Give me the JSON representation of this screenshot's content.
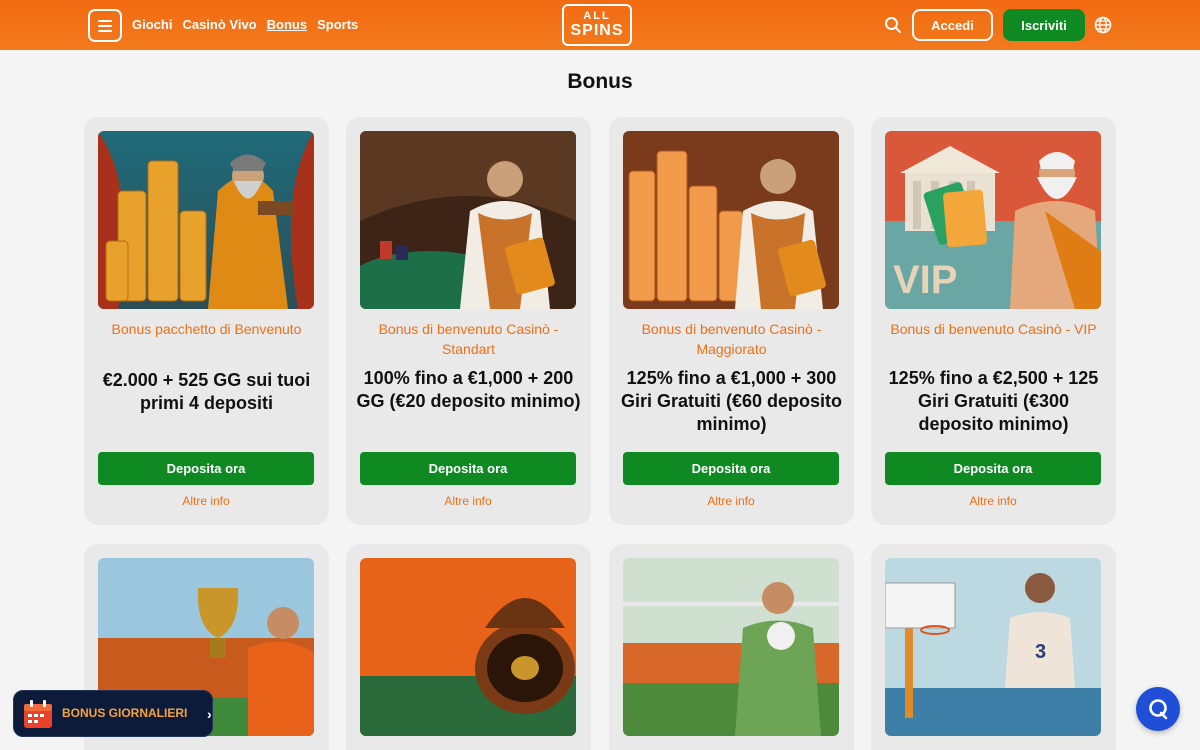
{
  "header": {
    "nav": [
      {
        "label": "Giochi",
        "active": false
      },
      {
        "label": "Casinò Vivo",
        "active": false
      },
      {
        "label": "Bonus",
        "active": true
      },
      {
        "label": "Sports",
        "active": false
      }
    ],
    "logo_top": "ALL",
    "logo_bottom": "SPINS",
    "login_label": "Accedi",
    "register_label": "Iscriviti",
    "icons": [
      "menu-icon",
      "search-icon",
      "globe-icon"
    ]
  },
  "page": {
    "title": "Bonus"
  },
  "bonus_cards": [
    {
      "subtitle": "Bonus pacchetto di Benvenuto",
      "offer": "€2.000 + 525 GG sui tuoi primi 4 depositi",
      "cta": "Deposita ora",
      "more": "Altre info",
      "image": "wizard-with-coin-stacks"
    },
    {
      "subtitle": "Bonus di benvenuto Casinò - Standart",
      "offer": "100% fino a €1,000 + 200 GG (€20 deposito minimo)",
      "cta": "Deposita ora",
      "more": "Altre info",
      "image": "croupier-at-table"
    },
    {
      "subtitle": "Bonus di benvenuto Casinò - Maggiorato",
      "offer": "125% fino a €1,000 + 300 Giri Gratuiti (€60 deposito minimo)",
      "cta": "Deposita ora",
      "more": "Altre info",
      "image": "croupier-with-coin-stacks"
    },
    {
      "subtitle": "Bonus di benvenuto Casinò - VIP",
      "offer": "125% fino a €2,500 + 125 Giri Gratuiti (€300 deposito minimo)",
      "cta": "Deposita ora",
      "more": "Altre info",
      "image": "vip-god-with-cards"
    }
  ],
  "sport_cards": [
    {
      "image": "football-player-with-trophy"
    },
    {
      "image": "roulette-wheel"
    },
    {
      "image": "goalkeeper-with-ball"
    },
    {
      "image": "basketball-player"
    }
  ],
  "daily_bonus": {
    "label": "BONUS GIORNALIERI",
    "icon": "gift-calendar-icon"
  },
  "chat": {
    "icon": "chat-icon"
  },
  "colors": {
    "header": "#f27016",
    "accent": "#ef6f13",
    "cta": "#0f8a23",
    "card_bg": "#e9e9e9",
    "daily_bg": "#0d1b3b",
    "chat": "#1e4fd6"
  }
}
